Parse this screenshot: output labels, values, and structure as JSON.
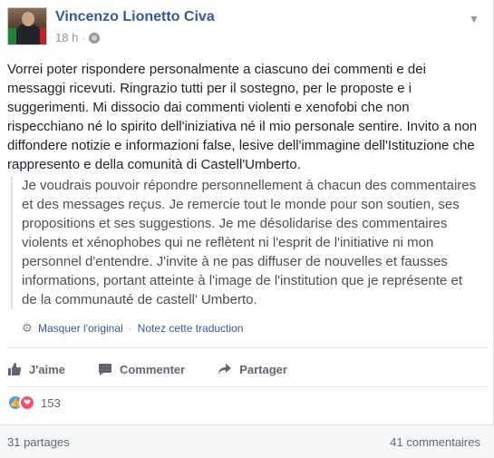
{
  "post": {
    "author_name": "Vincenzo Lionetto Civa",
    "timestamp": "18 h",
    "meta_separator": "·",
    "privacy_icon": "globe-icon",
    "options_icon": "chevron-down-icon",
    "text": "Vorrei poter rispondere personalmente a ciascuno dei commenti e dei messaggi ricevuti. Ringrazio tutti per il sostegno, per le proposte e i suggerimenti. Mi dissocio dai commenti violenti e xenofobi che non rispecchiano né lo spirito dell'iniziativa né il mio personale sentire. Invito a non diffondere notizie e informazioni false, lesive dell'immagine dell'Istituzione che rappresento e della comunità di Castell'Umberto.",
    "translation_text": "Je voudrais pouvoir répondre personnellement à chacun des commentaires et des messages reçus. Je remercie tout le monde pour son soutien, ses propositions et ses suggestions. Je me désolidarise des commentaires violents et xénophobes qui ne reflètent ni l'esprit de l'initiative ni mon personnel d'entendre. J'invite à ne pas diffuser de nouvelles et fausses informations, portant atteinte à l'image de l'institution que je représente et de la communauté de castell' Umberto.",
    "translation_actions": {
      "hide_original": "Masquer l'original",
      "separator": "·",
      "rate_translation": "Notez cette traduction"
    }
  },
  "actions": {
    "like": "J'aime",
    "comment": "Commenter",
    "share": "Partager"
  },
  "reactions": {
    "count": "153",
    "types": [
      "like",
      "love"
    ]
  },
  "footer": {
    "shares": "31 partages",
    "comments": "41 commentaires"
  },
  "colors": {
    "link": "#365899",
    "meta": "#90949c",
    "action": "#606770",
    "like": "#5890ff",
    "love": "#f25268"
  }
}
